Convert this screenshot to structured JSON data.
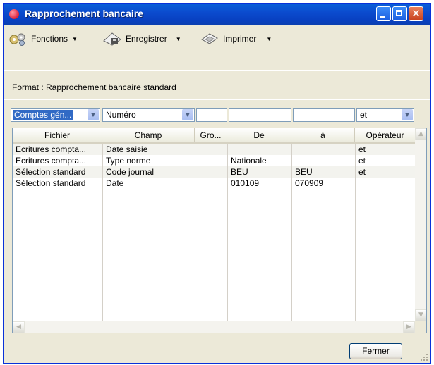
{
  "window": {
    "title": "Rapprochement bancaire"
  },
  "toolbar": {
    "items": [
      {
        "label": "Fonctions",
        "icon": "gears-icon"
      },
      {
        "label": "Enregistrer",
        "icon": "save-document-icon"
      },
      {
        "label": "Imprimer",
        "icon": "print-icon"
      }
    ]
  },
  "format": {
    "label": "Format : Rapprochement bancaire standard"
  },
  "filters": {
    "fichier_select": "Comptes gén...",
    "champ_select": "Numéro",
    "gro_value": "",
    "de_value": "",
    "a_value": "",
    "operateur_select": "et"
  },
  "table": {
    "columns": [
      "Fichier",
      "Champ",
      "Gro...",
      "De",
      "à",
      "Opérateur"
    ],
    "rows": [
      [
        "Ecritures compta...",
        "Date saisie",
        "",
        "",
        "",
        "et"
      ],
      [
        "Ecritures compta...",
        "Type norme",
        "",
        "Nationale",
        "",
        "et"
      ],
      [
        "Sélection standard",
        "Code journal",
        "",
        "BEU",
        "BEU",
        "et"
      ],
      [
        "Sélection standard",
        "Date",
        "",
        "010109",
        "070909",
        ""
      ]
    ]
  },
  "buttons": {
    "close": "Fermer"
  },
  "colors": {
    "titlebar": "#0a5fd8",
    "selection": "#316ac5"
  }
}
